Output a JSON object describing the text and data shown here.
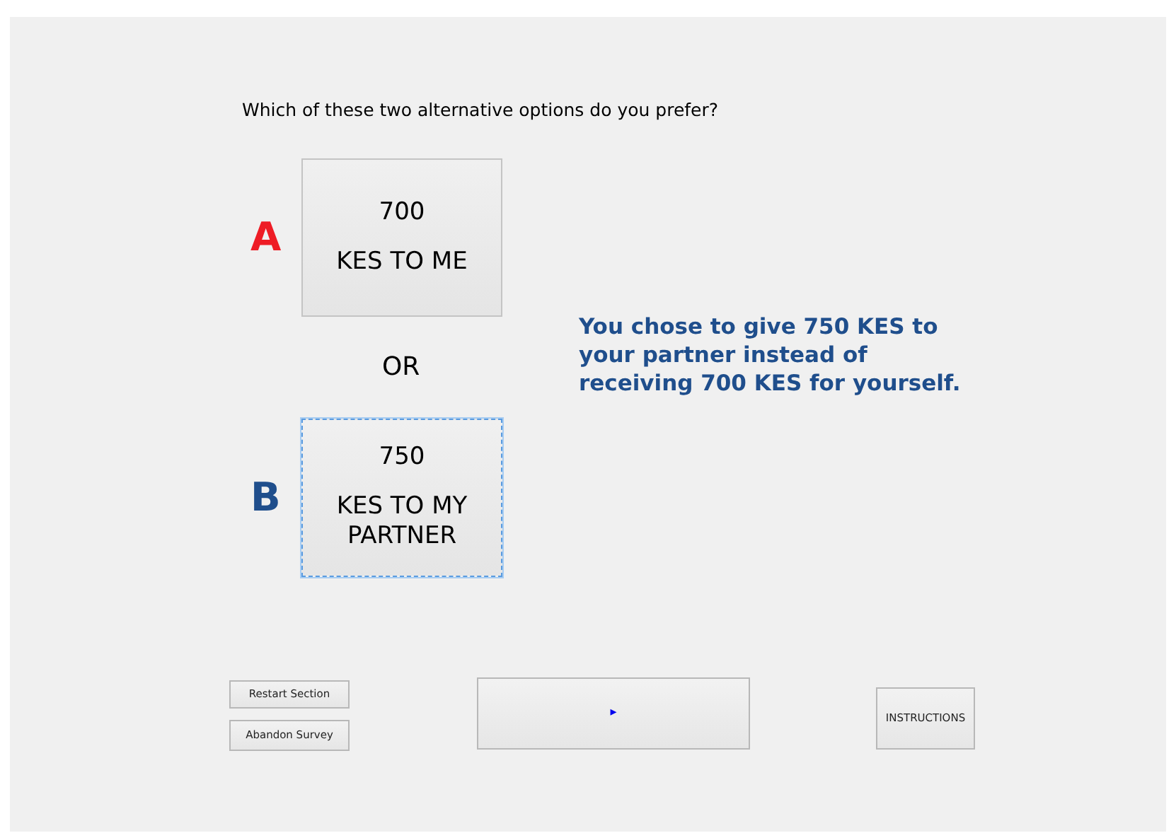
{
  "question": "Which of these two alternative options do you prefer?",
  "options": [
    {
      "letter": "A",
      "color": "#ee1c25",
      "amount": "700",
      "label": "KES TO ME",
      "selected": false
    },
    {
      "letter": "B",
      "color": "#1f4e8c",
      "amount": "750",
      "label": "KES TO MY PARTNER",
      "selected": true
    }
  ],
  "separator": "OR",
  "message": "You chose to give 750 KES to your partner instead of receiving 700 KES for yourself.",
  "side_buttons": [
    "Restart Section",
    "Abandon Survey"
  ],
  "next_button": {
    "icon": "▸"
  },
  "instructions_button": "INSTRUCTIONS"
}
